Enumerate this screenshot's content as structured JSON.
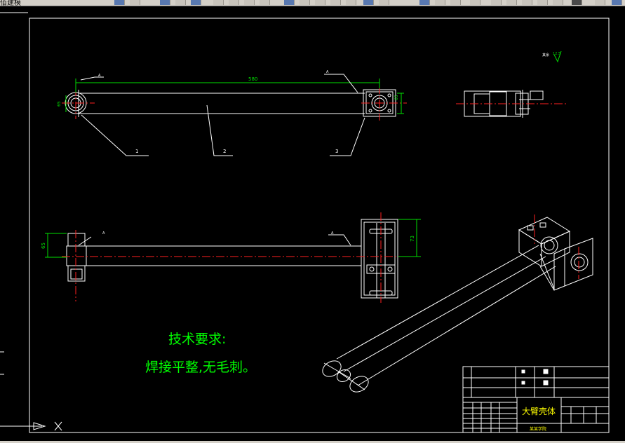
{
  "toolbar": {
    "partial_label": "佰建模"
  },
  "drawing": {
    "dimensions": {
      "length": "580",
      "height_side": "65",
      "height_flange": "73",
      "height_small": "65"
    },
    "leaders": {
      "a1": "A",
      "a2": "A",
      "a3": "A",
      "a4": "A"
    },
    "balloons": [
      "1",
      "2",
      "3"
    ],
    "roughness": "其余",
    "roughness_value": "12.5",
    "notes": {
      "heading": "技术要求:",
      "line1": "焊接平整,无毛刺。"
    },
    "title_block": {
      "part_name": "大臂壳体",
      "school": "某某学院"
    }
  },
  "colors": {
    "drawing_line": "#ffffff",
    "center_line": "#ff2020",
    "dimension": "#00e000",
    "note_text": "#00ff00",
    "toolbar": "#d4d0c8"
  }
}
